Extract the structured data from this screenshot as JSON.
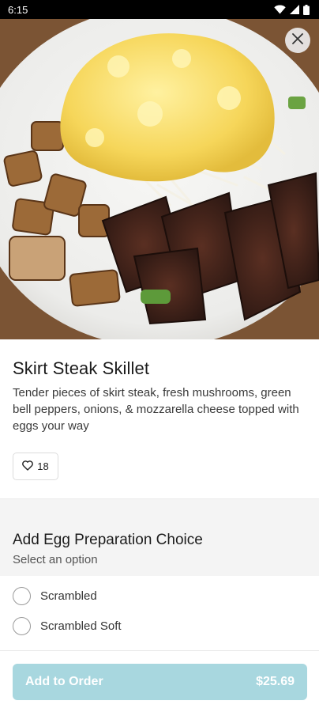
{
  "status_bar": {
    "time": "6:15",
    "icons": [
      "wifi-icon",
      "cell-signal-icon",
      "battery-icon"
    ]
  },
  "hero": {
    "image_alt_icon": "food-photo",
    "close_icon": "close-icon"
  },
  "item": {
    "title": "Skirt Steak Skillet",
    "description": "Tender pieces of skirt steak, fresh mushrooms, green bell peppers, onions, & mozzarella cheese topped with eggs your way",
    "likes": "18",
    "like_icon": "heart-outline-icon"
  },
  "modifier": {
    "title": "Add Egg Preparation Choice",
    "subtitle": "Select an option",
    "options": [
      {
        "label": "Scrambled",
        "selected": false
      },
      {
        "label": "Scrambled Soft",
        "selected": false
      }
    ]
  },
  "footer": {
    "add_label": "Add to Order",
    "price": "$25.69"
  },
  "colors": {
    "button_bg": "#a8d7df",
    "button_text": "#ffffff",
    "section_bg": "#f4f4f4"
  }
}
